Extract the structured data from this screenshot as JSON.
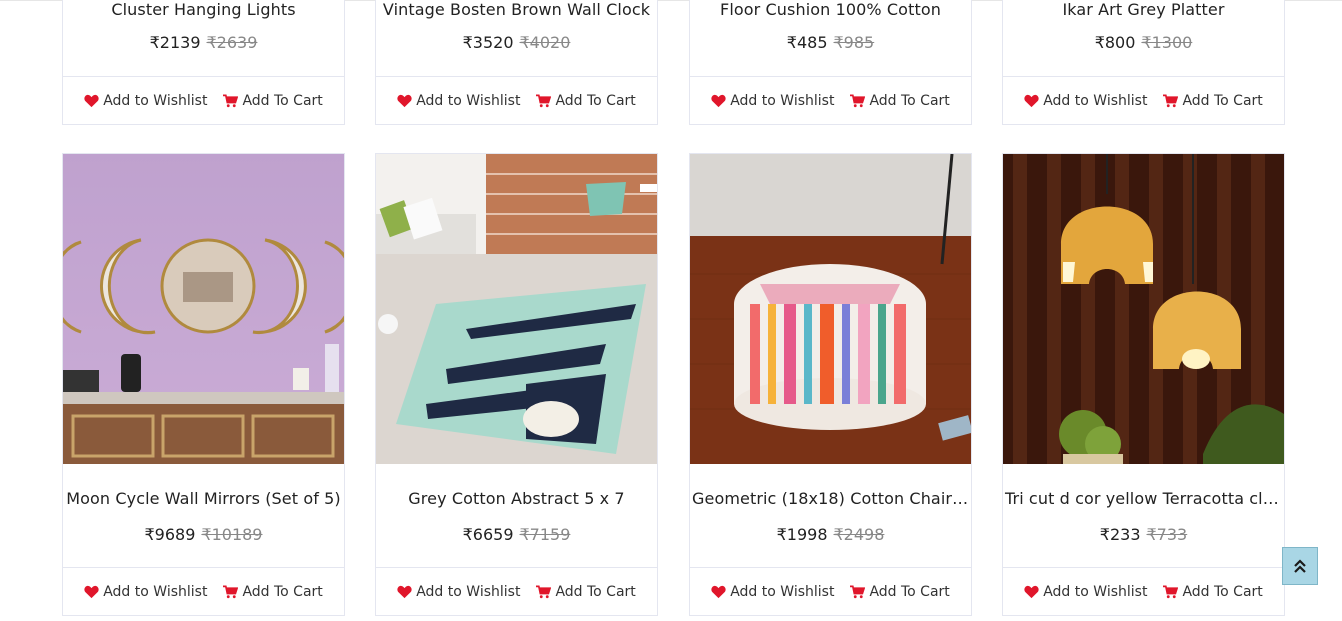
{
  "products_top": [
    {
      "title": "Cluster Hanging Lights",
      "price": "₹2139",
      "old_price": "₹2639"
    },
    {
      "title": "Vintage Bosten Brown Wall Clock",
      "price": "₹3520",
      "old_price": "₹4020"
    },
    {
      "title": "Floor Cushion 100% Cotton",
      "price": "₹485",
      "old_price": "₹985"
    },
    {
      "title": "Ikar Art Grey Platter",
      "price": "₹800",
      "old_price": "₹1300"
    }
  ],
  "products_bottom": [
    {
      "title": "Moon Cycle Wall Mirrors (Set of 5)",
      "price": "₹9689",
      "old_price": "₹10189"
    },
    {
      "title": "Grey Cotton Abstract 5 x 7",
      "price": "₹6659",
      "old_price": "₹7159"
    },
    {
      "title": "Geometric (18x18) Cotton Chair C...",
      "price": "₹1998",
      "old_price": "₹2498"
    },
    {
      "title": "Tri cut d cor yellow Terracotta clu...",
      "price": "₹233",
      "old_price": "₹733"
    }
  ],
  "actions": {
    "wishlist_label": "Add to Wishlist",
    "cart_label": "Add To Cart"
  },
  "colors": {
    "accent_red": "#e0162b",
    "scroll_button_bg": "#a9d6e5",
    "border": "#e4e6f0"
  },
  "icons": {
    "wishlist": "heart-icon",
    "cart": "cart-icon",
    "scroll": "double-chevron-up-icon"
  }
}
